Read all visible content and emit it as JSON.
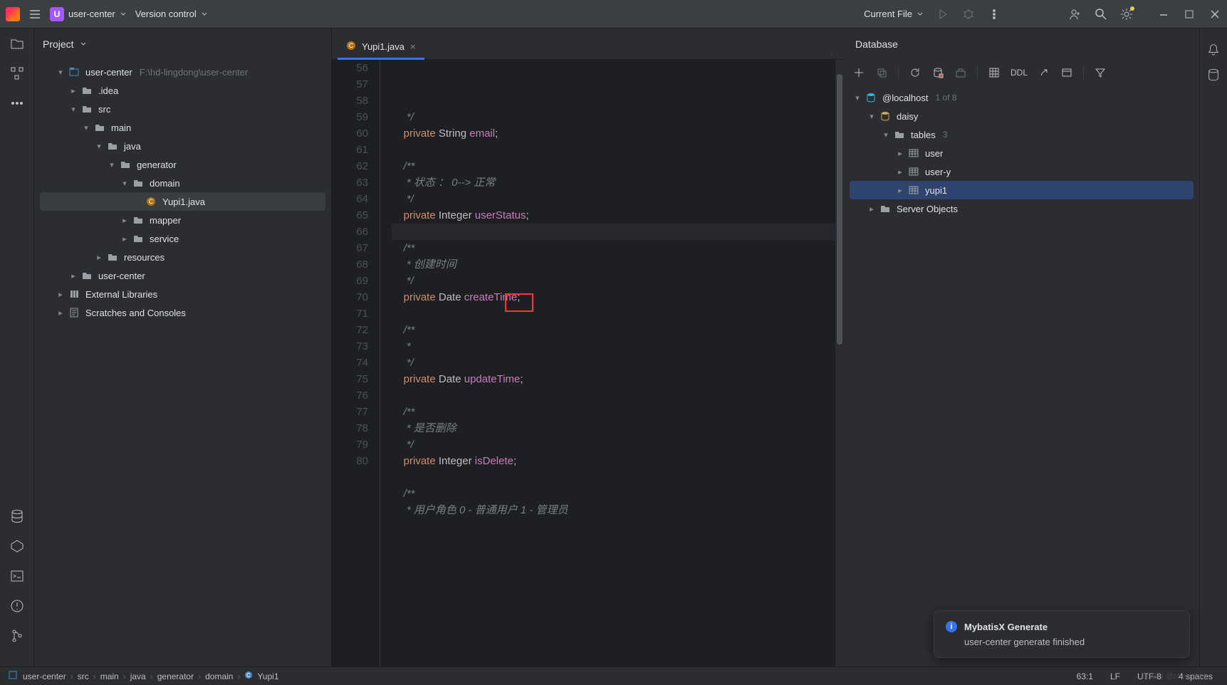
{
  "titlebar": {
    "project_badge": "U",
    "project_name": "user-center",
    "vcs": "Version control",
    "run_config": "Current File"
  },
  "project": {
    "title": "Project",
    "root": {
      "name": "user-center",
      "path": "F:\\hd-lingdong\\user-center"
    },
    "nodes": [
      {
        "indent": 1,
        "chev": "▾",
        "icon": "module",
        "label": "user-center",
        "path": "F:\\hd-lingdong\\user-center"
      },
      {
        "indent": 2,
        "chev": "▸",
        "icon": "folder",
        "label": ".idea"
      },
      {
        "indent": 2,
        "chev": "▾",
        "icon": "folder",
        "label": "src"
      },
      {
        "indent": 3,
        "chev": "▾",
        "icon": "folder",
        "label": "main"
      },
      {
        "indent": 4,
        "chev": "▾",
        "icon": "folder",
        "label": "java"
      },
      {
        "indent": 5,
        "chev": "▾",
        "icon": "package",
        "label": "generator"
      },
      {
        "indent": 6,
        "chev": "▾",
        "icon": "package",
        "label": "domain"
      },
      {
        "indent": 7,
        "chev": "",
        "icon": "class",
        "label": "Yupi1.java",
        "selected": true
      },
      {
        "indent": 6,
        "chev": "▸",
        "icon": "package",
        "label": "mapper"
      },
      {
        "indent": 6,
        "chev": "▸",
        "icon": "package",
        "label": "service"
      },
      {
        "indent": 4,
        "chev": "▸",
        "icon": "folder",
        "label": "resources"
      },
      {
        "indent": 2,
        "chev": "▸",
        "icon": "folder",
        "label": "user-center"
      },
      {
        "indent": 1,
        "chev": "▸",
        "icon": "lib",
        "label": "External Libraries"
      },
      {
        "indent": 1,
        "chev": "▸",
        "icon": "scratch",
        "label": "Scratches and Consoles"
      }
    ]
  },
  "editor": {
    "tab": "Yupi1.java",
    "first_line": 56,
    "caret_line": 63,
    "lines": [
      {
        "t": "comment",
        "text": "     */"
      },
      {
        "t": "code",
        "kw": "private",
        "type": "String",
        "name": "email"
      },
      {
        "t": "blank"
      },
      {
        "t": "comment",
        "text": "    /**"
      },
      {
        "t": "comment",
        "text": "     * 状态 ： 0--> 正常"
      },
      {
        "t": "comment",
        "text": "     */"
      },
      {
        "t": "code",
        "kw": "private",
        "type": "Integer",
        "name": "userStatus"
      },
      {
        "t": "caret"
      },
      {
        "t": "comment",
        "text": "    /**"
      },
      {
        "t": "comment",
        "text": "     * 创建时间"
      },
      {
        "t": "comment",
        "text": "     */"
      },
      {
        "t": "code",
        "kw": "private",
        "type": "Date",
        "name": "createTime"
      },
      {
        "t": "blank"
      },
      {
        "t": "comment",
        "text": "    /**"
      },
      {
        "t": "comment",
        "text": "     *"
      },
      {
        "t": "comment",
        "text": "     */"
      },
      {
        "t": "code",
        "kw": "private",
        "type": "Date",
        "name": "updateTime"
      },
      {
        "t": "blank"
      },
      {
        "t": "comment",
        "text": "    /**"
      },
      {
        "t": "comment",
        "text": "     * 是否删除"
      },
      {
        "t": "comment",
        "text": "     */"
      },
      {
        "t": "code",
        "kw": "private",
        "type": "Integer",
        "name": "isDelete"
      },
      {
        "t": "blank"
      },
      {
        "t": "comment",
        "text": "    /**"
      },
      {
        "t": "comment",
        "text": "     * 用户角色 0 - 普通用户 1 - 管理员"
      }
    ]
  },
  "database": {
    "title": "Database",
    "ddl": "DDL",
    "nodes": [
      {
        "indent": 0,
        "chev": "▾",
        "icon": "ds",
        "label": "@localhost",
        "count": "1 of 8"
      },
      {
        "indent": 1,
        "chev": "▾",
        "icon": "schema",
        "label": "daisy"
      },
      {
        "indent": 2,
        "chev": "▾",
        "icon": "folder",
        "label": "tables",
        "count": "3"
      },
      {
        "indent": 3,
        "chev": "▸",
        "icon": "table",
        "label": "user"
      },
      {
        "indent": 3,
        "chev": "▸",
        "icon": "table",
        "label": "user-y"
      },
      {
        "indent": 3,
        "chev": "▸",
        "icon": "table",
        "label": "yupi1",
        "selected": true
      },
      {
        "indent": 1,
        "chev": "▸",
        "icon": "folder",
        "label": "Server Objects"
      }
    ]
  },
  "status": {
    "crumbs": [
      "user-center",
      "src",
      "main",
      "java",
      "generator",
      "domain",
      "Yupi1"
    ],
    "pos": "63:1",
    "eol": "LF",
    "enc": "UTF-8",
    "indent": "4 spaces"
  },
  "notification": {
    "title": "MybatisX Generate",
    "message": "user-center generate finished"
  },
  "watermark": "CSDN @chemddd"
}
